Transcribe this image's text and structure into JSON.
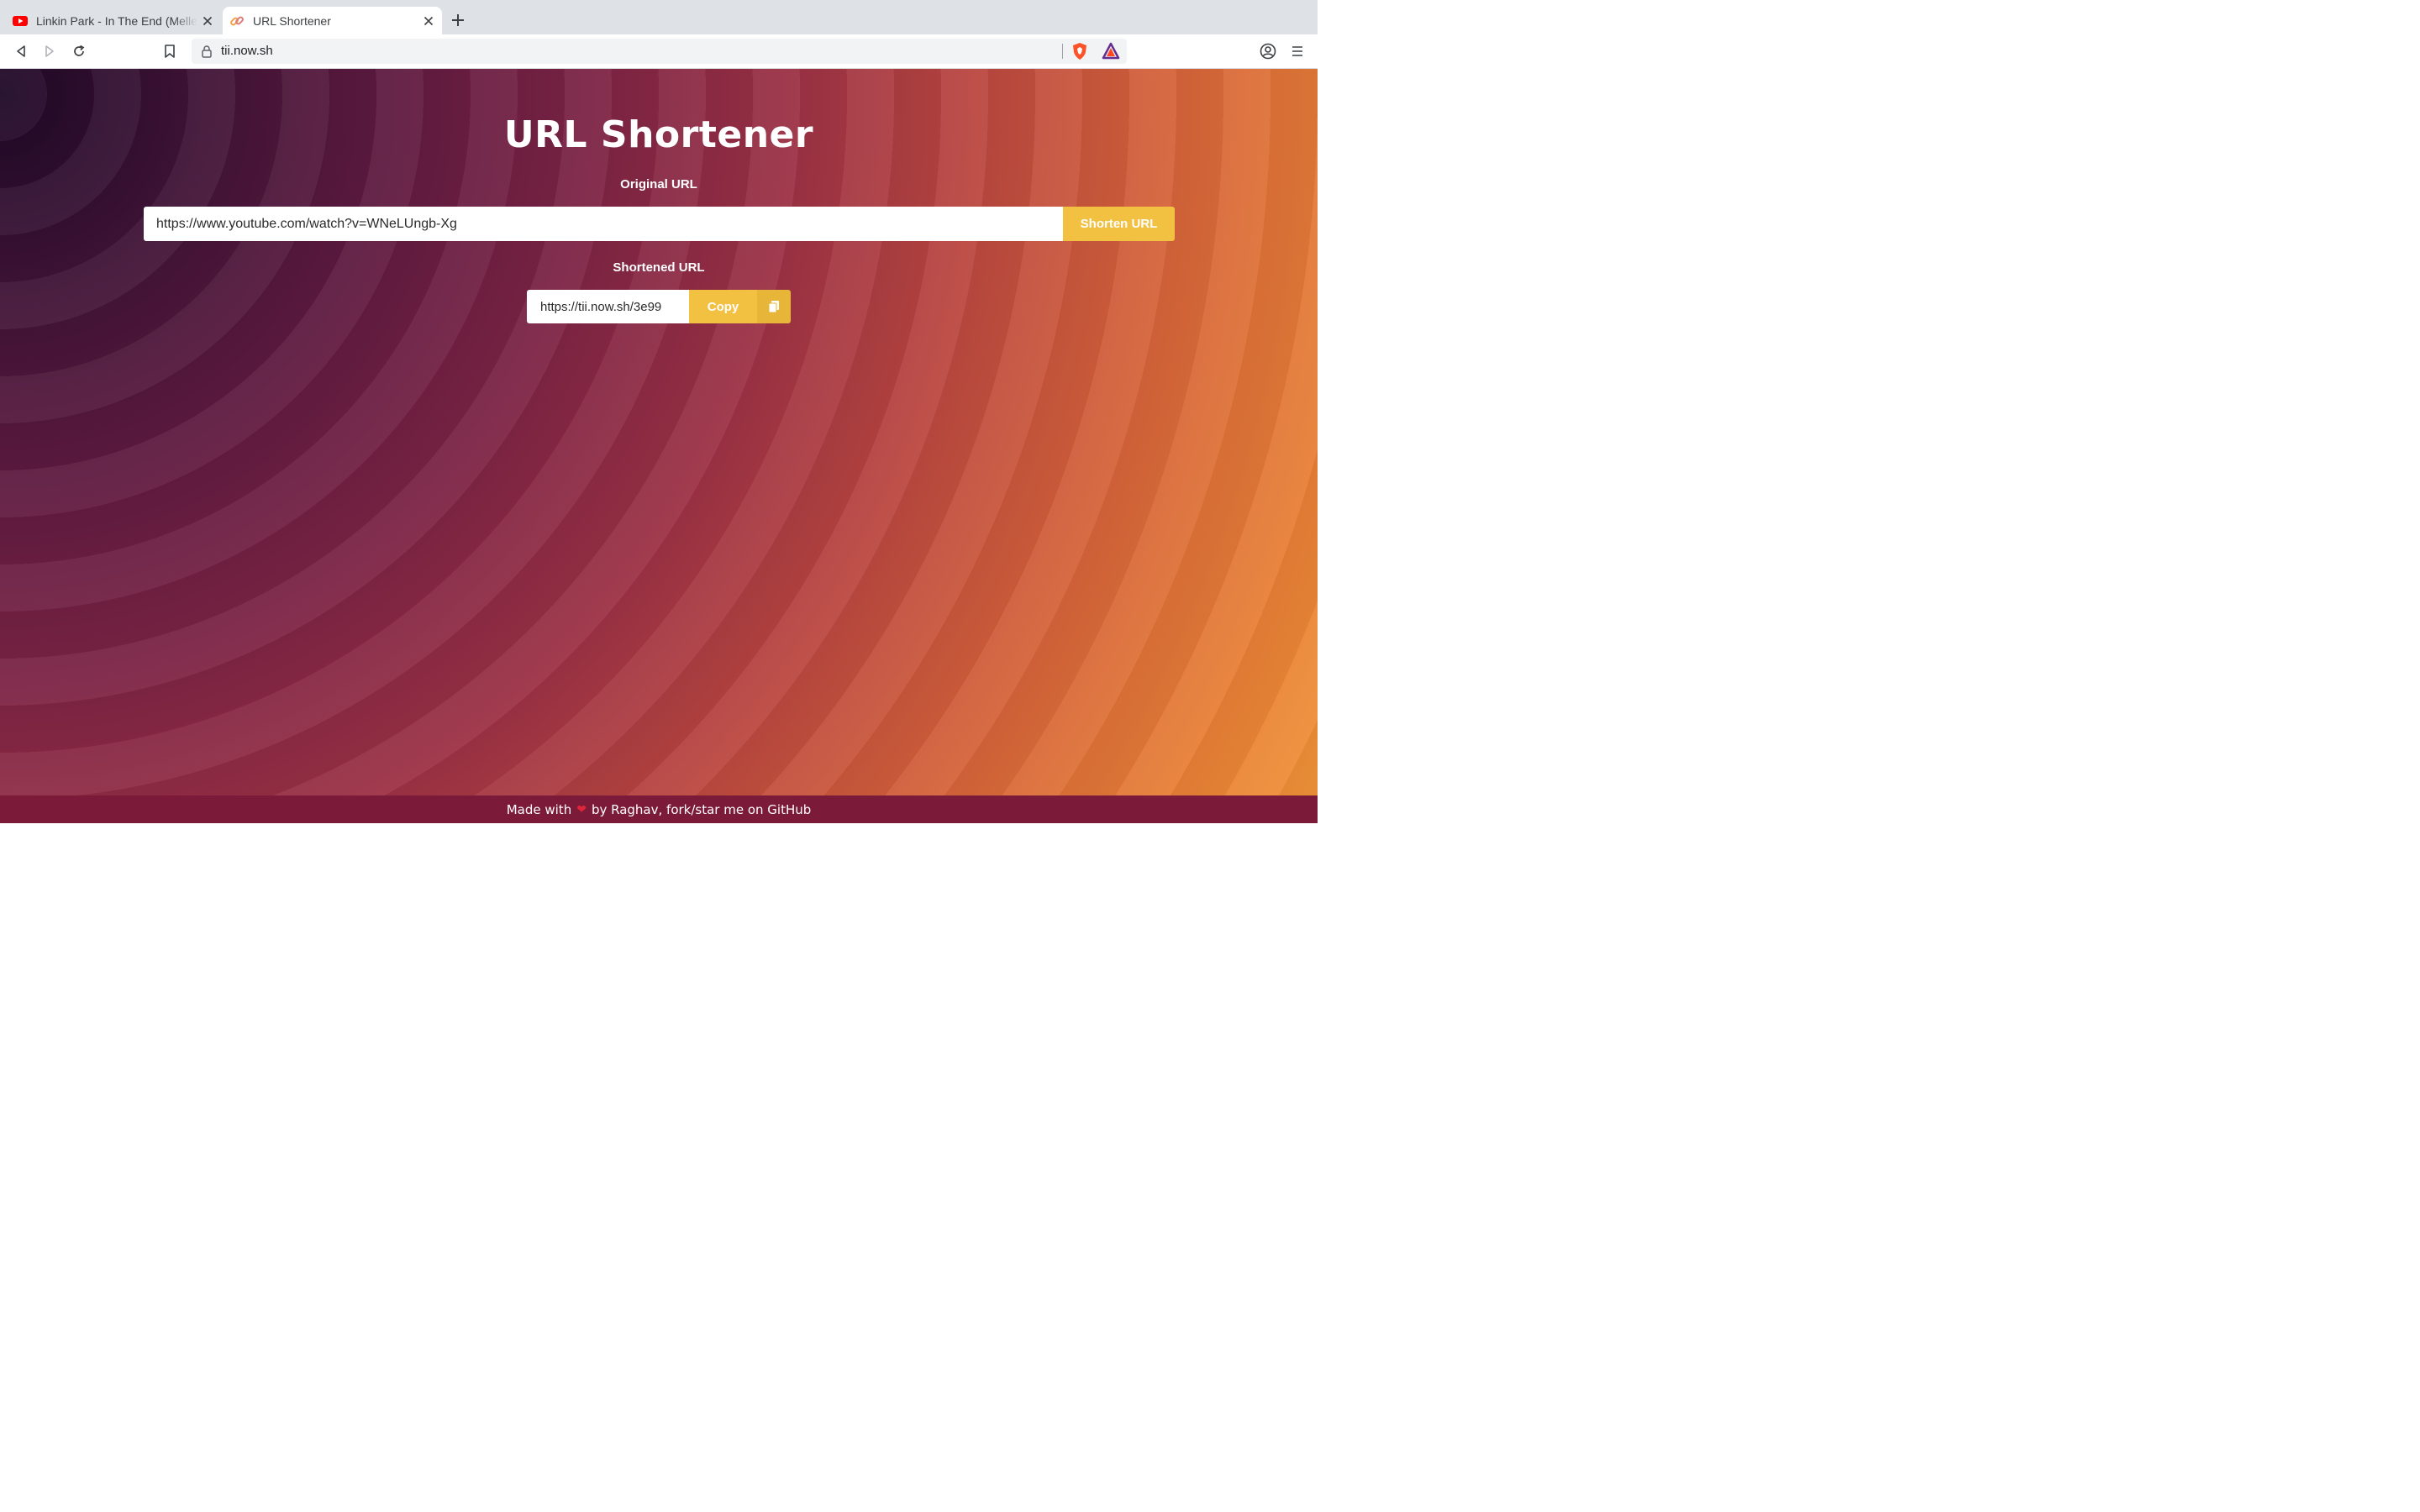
{
  "browser": {
    "tabs": [
      {
        "title": "Linkin Park - In The End (Mellen Gi",
        "favicon": "youtube-icon",
        "active": false
      },
      {
        "title": "URL Shortener",
        "favicon": "link-icon",
        "active": true
      }
    ],
    "address_bar": {
      "url": "tii.now.sh"
    }
  },
  "page": {
    "title": "URL Shortener",
    "original_label": "Original URL",
    "original_value": "https://www.youtube.com/watch?v=WNeLUngb-Xg",
    "shorten_button": "Shorten URL",
    "shortened_label": "Shortened URL",
    "shortened_value": "https://tii.now.sh/3e99",
    "copy_button": "Copy"
  },
  "footer": {
    "made_with": "Made with",
    "by_text": "by Raghav,",
    "github_link": "fork/star me on GitHub"
  },
  "colors": {
    "accent": "#f3c141",
    "footer_bg": "#7c1a3a",
    "youtube_red": "#ff0000"
  }
}
